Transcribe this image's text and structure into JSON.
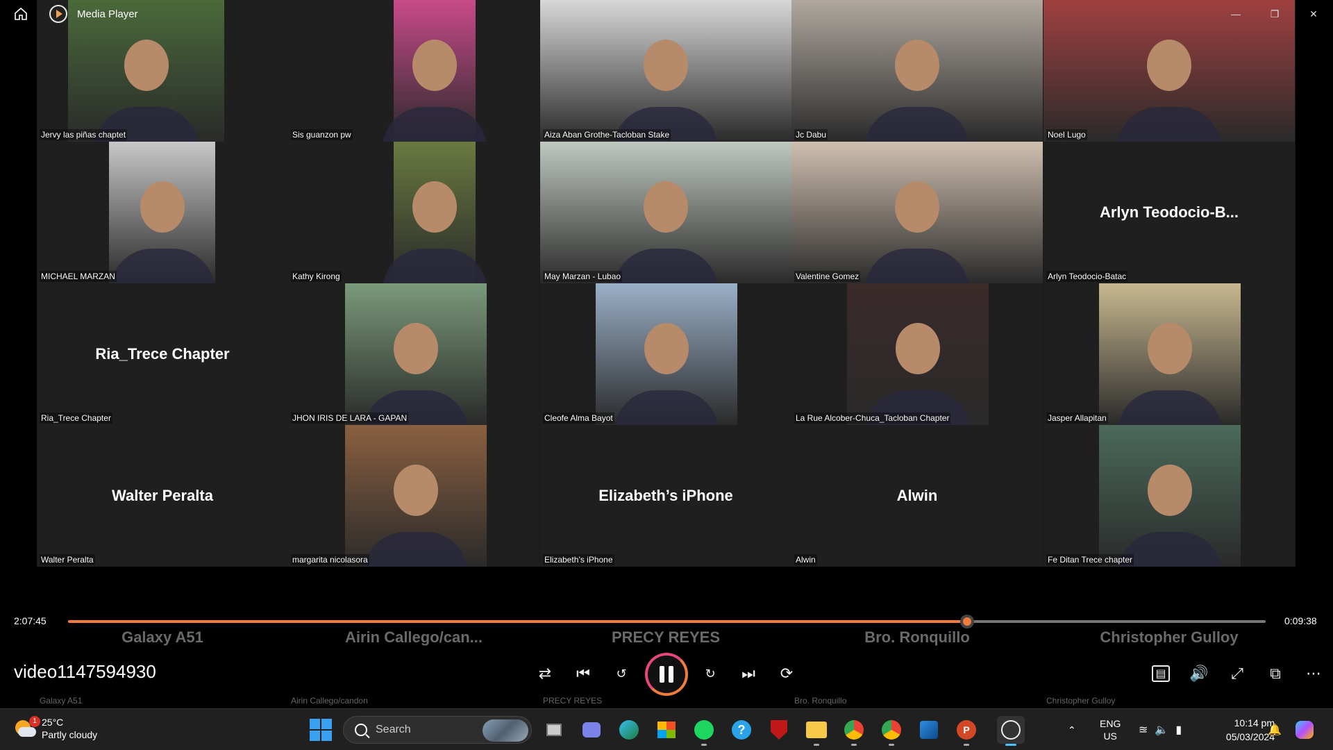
{
  "window": {
    "title": "Media Player",
    "controls": [
      "minimize-icon",
      "restore-icon",
      "close-icon"
    ]
  },
  "gallery": {
    "tiles": [
      {
        "label": "Jervy las piñas chaptet",
        "big": "",
        "bg": "#4a6a3a"
      },
      {
        "label": "Sis guanzon pw",
        "big": "",
        "bg": "#c94a8a"
      },
      {
        "label": "Aiza Aban Grothe-Tacloban Stake",
        "big": "",
        "bg": "#d8d8d8"
      },
      {
        "label": "Jc Dabu",
        "big": "",
        "bg": "#b0a8a0"
      },
      {
        "label": "Noel Lugo",
        "big": "",
        "bg": "#a04040"
      },
      {
        "label": "MICHAEL MARZAN",
        "big": "",
        "bg": "#c8c8c8"
      },
      {
        "label": "Kathy Kirong",
        "big": "",
        "bg": "#6a7a40"
      },
      {
        "label": "May Marzan - Lubao",
        "big": "",
        "bg": "#c0c8c0"
      },
      {
        "label": "Valentine Gomez",
        "big": "",
        "bg": "#d0c0b0"
      },
      {
        "label": "Arlyn Teodocio-Batac",
        "big": "Arlyn  Teodocio-B...",
        "bg": ""
      },
      {
        "label": "Ria_Trece Chapter",
        "big": "Ria_Trece Chapter",
        "bg": ""
      },
      {
        "label": "JHON IRIS DE LARA - GAPAN",
        "big": "",
        "bg": "#7a9a7a"
      },
      {
        "label": "Cleofe Alma Bayot",
        "big": "",
        "bg": "#9ab0c8"
      },
      {
        "label": "La Rue Alcober-Chuca_Tacloban Chapter",
        "big": "",
        "bg": "#3a2a2a"
      },
      {
        "label": "Jasper Allapitan",
        "big": "",
        "bg": "#c8b890"
      },
      {
        "label": "Walter Peralta",
        "big": "Walter Peralta",
        "bg": ""
      },
      {
        "label": "margarita nicolasora",
        "big": "",
        "bg": "#8a6040"
      },
      {
        "label": "Elizabeth’s iPhone",
        "big": "Elizabeth’s iPhone",
        "bg": ""
      },
      {
        "label": "Alwin",
        "big": "Alwin",
        "bg": ""
      },
      {
        "label": "Fe Ditan Trece chapter",
        "big": "",
        "bg": "#4a6a5a"
      }
    ],
    "ghost_names": [
      "Galaxy A51",
      "Airin  Callego/can...",
      "PRECY REYES",
      "Bro. Ronquillo",
      "Christopher Gulloy"
    ],
    "ghost_labels": [
      "Galaxy A51",
      "Airin Callego/candon",
      "PRECY REYES",
      "Bro. Ronquillo",
      "Christopher Gulloy"
    ]
  },
  "player": {
    "elapsed": "2:07:45",
    "remaining": "0:09:38",
    "progress": 0.751,
    "video_title": "video1147594930",
    "accent": "#f07d3c",
    "buttons": [
      "shuffle-icon",
      "previous-icon",
      "rewind-10-icon",
      "pause-icon",
      "forward-30-icon",
      "next-icon",
      "repeat-off-icon",
      "captions-icon",
      "volume-icon",
      "fullscreen-icon",
      "miniplayer-icon",
      "more-icon"
    ]
  },
  "taskbar": {
    "weather": {
      "temp": "25°C",
      "desc": "Partly cloudy",
      "badge": "1"
    },
    "search_placeholder": "Search",
    "lang": "ENG",
    "region": "US",
    "time": "10:14 pm",
    "date": "05/03/2024"
  }
}
